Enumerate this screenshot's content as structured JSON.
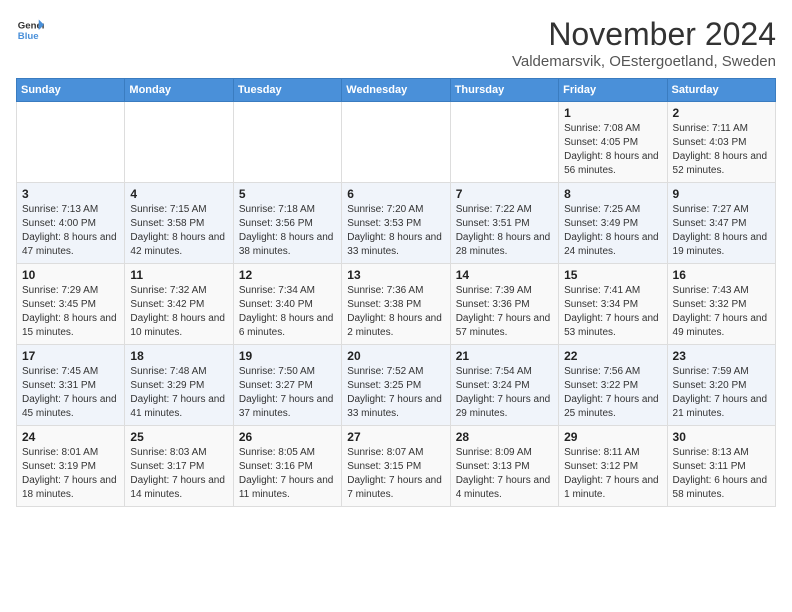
{
  "header": {
    "logo_general": "General",
    "logo_blue": "Blue",
    "title": "November 2024",
    "location": "Valdemarsvik, OEstergoetland, Sweden"
  },
  "days_of_week": [
    "Sunday",
    "Monday",
    "Tuesday",
    "Wednesday",
    "Thursday",
    "Friday",
    "Saturday"
  ],
  "weeks": [
    [
      {
        "day": "",
        "info": ""
      },
      {
        "day": "",
        "info": ""
      },
      {
        "day": "",
        "info": ""
      },
      {
        "day": "",
        "info": ""
      },
      {
        "day": "",
        "info": ""
      },
      {
        "day": "1",
        "info": "Sunrise: 7:08 AM\nSunset: 4:05 PM\nDaylight: 8 hours and 56 minutes."
      },
      {
        "day": "2",
        "info": "Sunrise: 7:11 AM\nSunset: 4:03 PM\nDaylight: 8 hours and 52 minutes."
      }
    ],
    [
      {
        "day": "3",
        "info": "Sunrise: 7:13 AM\nSunset: 4:00 PM\nDaylight: 8 hours and 47 minutes."
      },
      {
        "day": "4",
        "info": "Sunrise: 7:15 AM\nSunset: 3:58 PM\nDaylight: 8 hours and 42 minutes."
      },
      {
        "day": "5",
        "info": "Sunrise: 7:18 AM\nSunset: 3:56 PM\nDaylight: 8 hours and 38 minutes."
      },
      {
        "day": "6",
        "info": "Sunrise: 7:20 AM\nSunset: 3:53 PM\nDaylight: 8 hours and 33 minutes."
      },
      {
        "day": "7",
        "info": "Sunrise: 7:22 AM\nSunset: 3:51 PM\nDaylight: 8 hours and 28 minutes."
      },
      {
        "day": "8",
        "info": "Sunrise: 7:25 AM\nSunset: 3:49 PM\nDaylight: 8 hours and 24 minutes."
      },
      {
        "day": "9",
        "info": "Sunrise: 7:27 AM\nSunset: 3:47 PM\nDaylight: 8 hours and 19 minutes."
      }
    ],
    [
      {
        "day": "10",
        "info": "Sunrise: 7:29 AM\nSunset: 3:45 PM\nDaylight: 8 hours and 15 minutes."
      },
      {
        "day": "11",
        "info": "Sunrise: 7:32 AM\nSunset: 3:42 PM\nDaylight: 8 hours and 10 minutes."
      },
      {
        "day": "12",
        "info": "Sunrise: 7:34 AM\nSunset: 3:40 PM\nDaylight: 8 hours and 6 minutes."
      },
      {
        "day": "13",
        "info": "Sunrise: 7:36 AM\nSunset: 3:38 PM\nDaylight: 8 hours and 2 minutes."
      },
      {
        "day": "14",
        "info": "Sunrise: 7:39 AM\nSunset: 3:36 PM\nDaylight: 7 hours and 57 minutes."
      },
      {
        "day": "15",
        "info": "Sunrise: 7:41 AM\nSunset: 3:34 PM\nDaylight: 7 hours and 53 minutes."
      },
      {
        "day": "16",
        "info": "Sunrise: 7:43 AM\nSunset: 3:32 PM\nDaylight: 7 hours and 49 minutes."
      }
    ],
    [
      {
        "day": "17",
        "info": "Sunrise: 7:45 AM\nSunset: 3:31 PM\nDaylight: 7 hours and 45 minutes."
      },
      {
        "day": "18",
        "info": "Sunrise: 7:48 AM\nSunset: 3:29 PM\nDaylight: 7 hours and 41 minutes."
      },
      {
        "day": "19",
        "info": "Sunrise: 7:50 AM\nSunset: 3:27 PM\nDaylight: 7 hours and 37 minutes."
      },
      {
        "day": "20",
        "info": "Sunrise: 7:52 AM\nSunset: 3:25 PM\nDaylight: 7 hours and 33 minutes."
      },
      {
        "day": "21",
        "info": "Sunrise: 7:54 AM\nSunset: 3:24 PM\nDaylight: 7 hours and 29 minutes."
      },
      {
        "day": "22",
        "info": "Sunrise: 7:56 AM\nSunset: 3:22 PM\nDaylight: 7 hours and 25 minutes."
      },
      {
        "day": "23",
        "info": "Sunrise: 7:59 AM\nSunset: 3:20 PM\nDaylight: 7 hours and 21 minutes."
      }
    ],
    [
      {
        "day": "24",
        "info": "Sunrise: 8:01 AM\nSunset: 3:19 PM\nDaylight: 7 hours and 18 minutes."
      },
      {
        "day": "25",
        "info": "Sunrise: 8:03 AM\nSunset: 3:17 PM\nDaylight: 7 hours and 14 minutes."
      },
      {
        "day": "26",
        "info": "Sunrise: 8:05 AM\nSunset: 3:16 PM\nDaylight: 7 hours and 11 minutes."
      },
      {
        "day": "27",
        "info": "Sunrise: 8:07 AM\nSunset: 3:15 PM\nDaylight: 7 hours and 7 minutes."
      },
      {
        "day": "28",
        "info": "Sunrise: 8:09 AM\nSunset: 3:13 PM\nDaylight: 7 hours and 4 minutes."
      },
      {
        "day": "29",
        "info": "Sunrise: 8:11 AM\nSunset: 3:12 PM\nDaylight: 7 hours and 1 minute."
      },
      {
        "day": "30",
        "info": "Sunrise: 8:13 AM\nSunset: 3:11 PM\nDaylight: 6 hours and 58 minutes."
      }
    ]
  ]
}
